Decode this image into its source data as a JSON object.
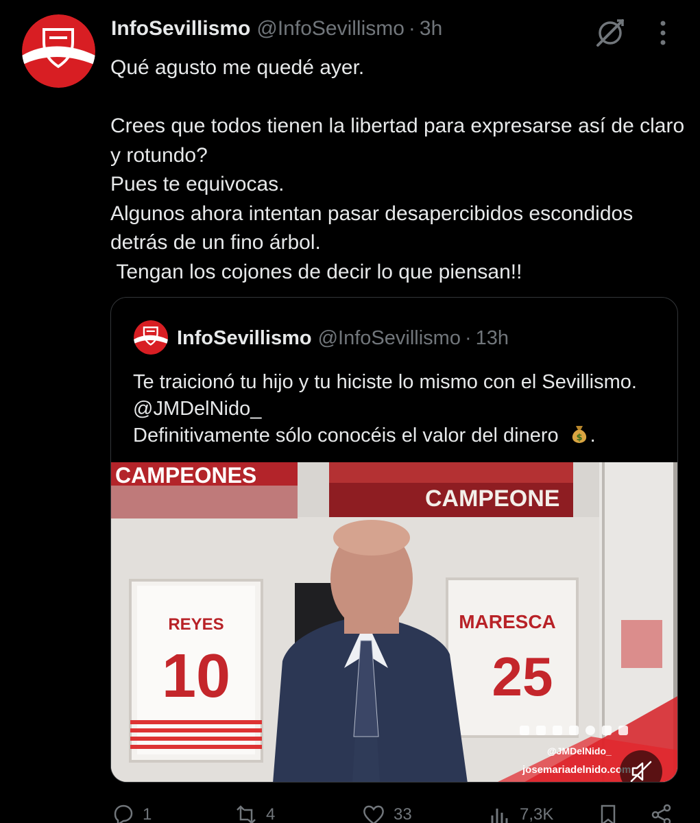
{
  "tweet": {
    "author_name": "InfoSevillismo",
    "author_handle": "@InfoSevillismo",
    "separator": "·",
    "time": "3h",
    "text": "Qué agusto me quedé ayer.\n\nCrees que todos tienen la libertad para expresarse así de claro y rotundo?\nPues te equivocas.\nAlgunos ahora intentan pasar desapercibidos escondidos detrás de un fino árbol.\n Tengan los cojones de decir lo que piensan!!"
  },
  "quoted_tweet": {
    "author_name": "InfoSevillismo",
    "author_handle": "@InfoSevillismo",
    "separator": "·",
    "time": "13h",
    "text": "Te traicionó tu hijo y tu hiciste lo mismo con el Sevillismo. @JMDelNido_\nDefinitivamente sólo conocéis el valor del dinero ",
    "text_end": ".",
    "emoji": "money-bag-icon"
  },
  "video": {
    "banner_left": "CAMPEONES",
    "banner_right": "CAMPEONE",
    "jersey_left_name": "REYES",
    "jersey_left_number": "10",
    "jersey_right_name": "MARESCA",
    "jersey_right_number": "25",
    "watermark_handle": "@JMDelNido_",
    "watermark_site": "josemariadelnido.com",
    "muted": true
  },
  "actions": {
    "replies": "1",
    "reposts": "4",
    "likes": "33",
    "views": "7,3K"
  },
  "colors": {
    "background": "#000000",
    "text_primary": "#e7e9ea",
    "text_secondary": "#71767b",
    "border": "#333639",
    "brand_red": "#d81e23"
  },
  "icons": [
    "grok-icon",
    "more-vertical-icon",
    "reply-icon",
    "repost-icon",
    "like-icon",
    "views-icon",
    "bookmark-icon",
    "share-icon",
    "mute-icon"
  ]
}
